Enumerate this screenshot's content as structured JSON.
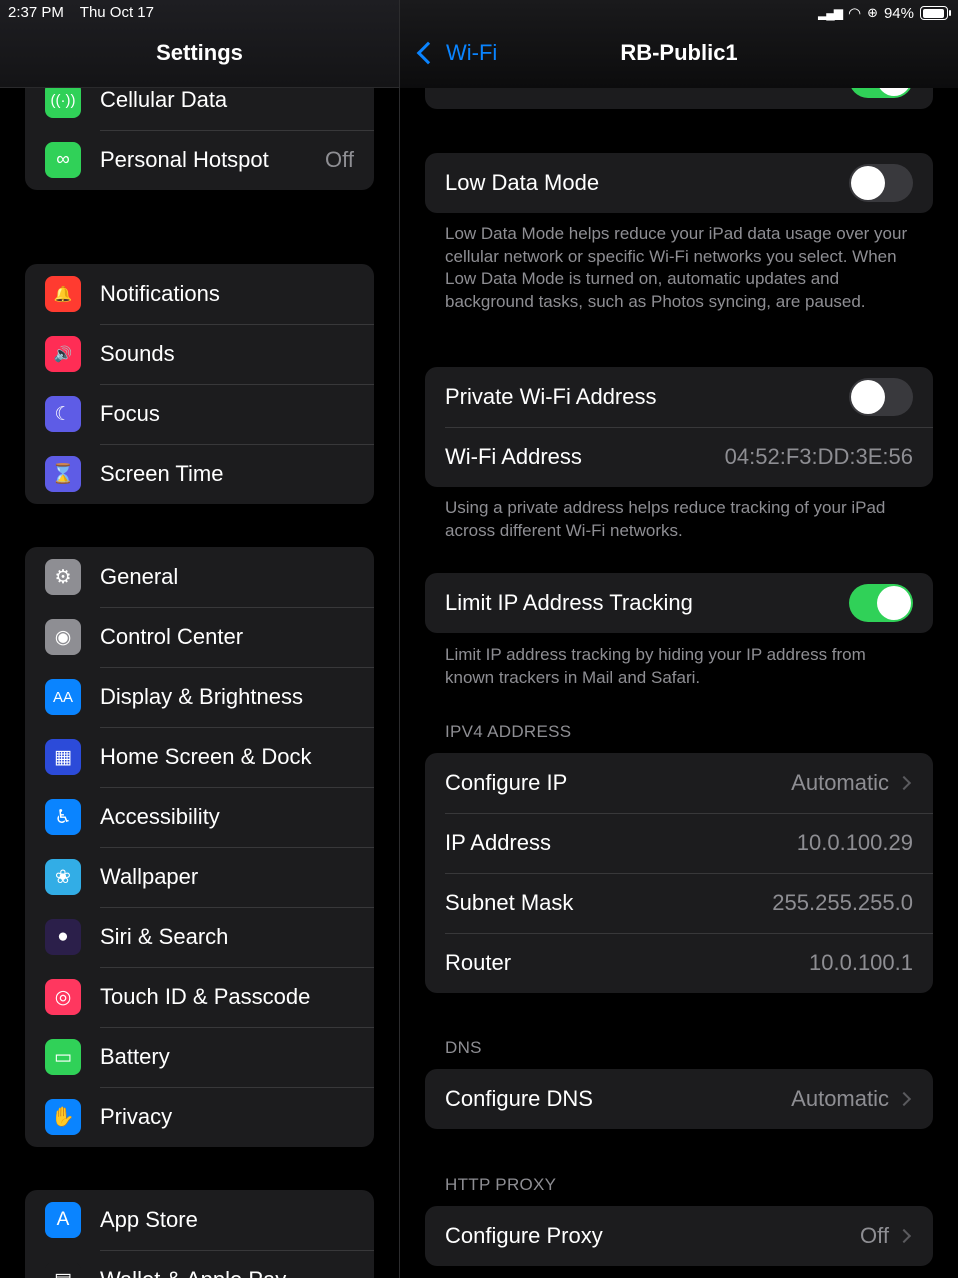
{
  "status": {
    "time": "2:37 PM",
    "date": "Thu Oct 17",
    "battery": "94%"
  },
  "sidebar": {
    "title": "Settings",
    "group1": [
      {
        "label": "Cellular Data",
        "icon": "antenna-icon",
        "color": "#30d158",
        "glyph": "((·))"
      },
      {
        "label": "Personal Hotspot",
        "value": "Off",
        "icon": "hotspot-icon",
        "color": "#30d158",
        "glyph": "∞"
      }
    ],
    "group2": [
      {
        "label": "Notifications",
        "icon": "bell-icon",
        "color": "#ff3b30",
        "glyph": "🔔"
      },
      {
        "label": "Sounds",
        "icon": "speaker-icon",
        "color": "#ff2d55",
        "glyph": "🔊"
      },
      {
        "label": "Focus",
        "icon": "moon-icon",
        "color": "#5e5ce6",
        "glyph": "☾"
      },
      {
        "label": "Screen Time",
        "icon": "hourglass-icon",
        "color": "#5e5ce6",
        "glyph": "⌛"
      }
    ],
    "group3": [
      {
        "label": "General",
        "icon": "gear-icon",
        "color": "#8e8e93",
        "glyph": "⚙"
      },
      {
        "label": "Control Center",
        "icon": "switches-icon",
        "color": "#8e8e93",
        "glyph": "◉"
      },
      {
        "label": "Display & Brightness",
        "icon": "text-size-icon",
        "color": "#0a84ff",
        "glyph": "AA"
      },
      {
        "label": "Home Screen & Dock",
        "icon": "grid-icon",
        "color": "#2c4bd9",
        "glyph": "▦"
      },
      {
        "label": "Accessibility",
        "icon": "accessibility-icon",
        "color": "#0a84ff",
        "glyph": "♿"
      },
      {
        "label": "Wallpaper",
        "icon": "flower-icon",
        "color": "#32ade6",
        "glyph": "❀"
      },
      {
        "label": "Siri & Search",
        "icon": "siri-icon",
        "color": "#2b1f4a",
        "glyph": "●"
      },
      {
        "label": "Touch ID & Passcode",
        "icon": "fingerprint-icon",
        "color": "#ff375f",
        "glyph": "◎"
      },
      {
        "label": "Battery",
        "icon": "battery-icon",
        "color": "#30d158",
        "glyph": "▭"
      },
      {
        "label": "Privacy",
        "icon": "hand-icon",
        "color": "#0a84ff",
        "glyph": "✋"
      }
    ],
    "group4": [
      {
        "label": "App Store",
        "icon": "app-store-icon",
        "color": "#0a84ff",
        "glyph": "A"
      },
      {
        "label": "Wallet & Apple Pay",
        "icon": "wallet-icon",
        "color": "#1c1c1e",
        "glyph": "▤"
      }
    ]
  },
  "detail": {
    "back_label": "Wi-Fi",
    "title": "RB-Public1",
    "low_data_mode": {
      "label": "Low Data Mode",
      "on": false
    },
    "low_data_note": "Low Data Mode helps reduce your iPad data usage over your cellular network or specific Wi-Fi networks you select. When Low Data Mode is turned on, automatic updates and background tasks, such as Photos syncing, are paused.",
    "private_address": {
      "label": "Private Wi-Fi Address",
      "on": false
    },
    "wifi_address": {
      "label": "Wi-Fi Address",
      "value": "04:52:F3:DD:3E:56"
    },
    "private_note": "Using a private address helps reduce tracking of your iPad across different Wi-Fi networks.",
    "limit_ip": {
      "label": "Limit IP Address Tracking",
      "on": true
    },
    "limit_note": "Limit IP address tracking by hiding your IP address from known trackers in Mail and Safari.",
    "ipv4_header": "IPV4 ADDRESS",
    "configure_ip": {
      "label": "Configure IP",
      "value": "Automatic"
    },
    "ip_address": {
      "label": "IP Address",
      "value": "10.0.100.29"
    },
    "subnet_mask": {
      "label": "Subnet Mask",
      "value": "255.255.255.0"
    },
    "router": {
      "label": "Router",
      "value": "10.0.100.1"
    },
    "dns_header": "DNS",
    "configure_dns": {
      "label": "Configure DNS",
      "value": "Automatic"
    },
    "proxy_header": "HTTP PROXY",
    "configure_proxy": {
      "label": "Configure Proxy",
      "value": "Off"
    }
  }
}
